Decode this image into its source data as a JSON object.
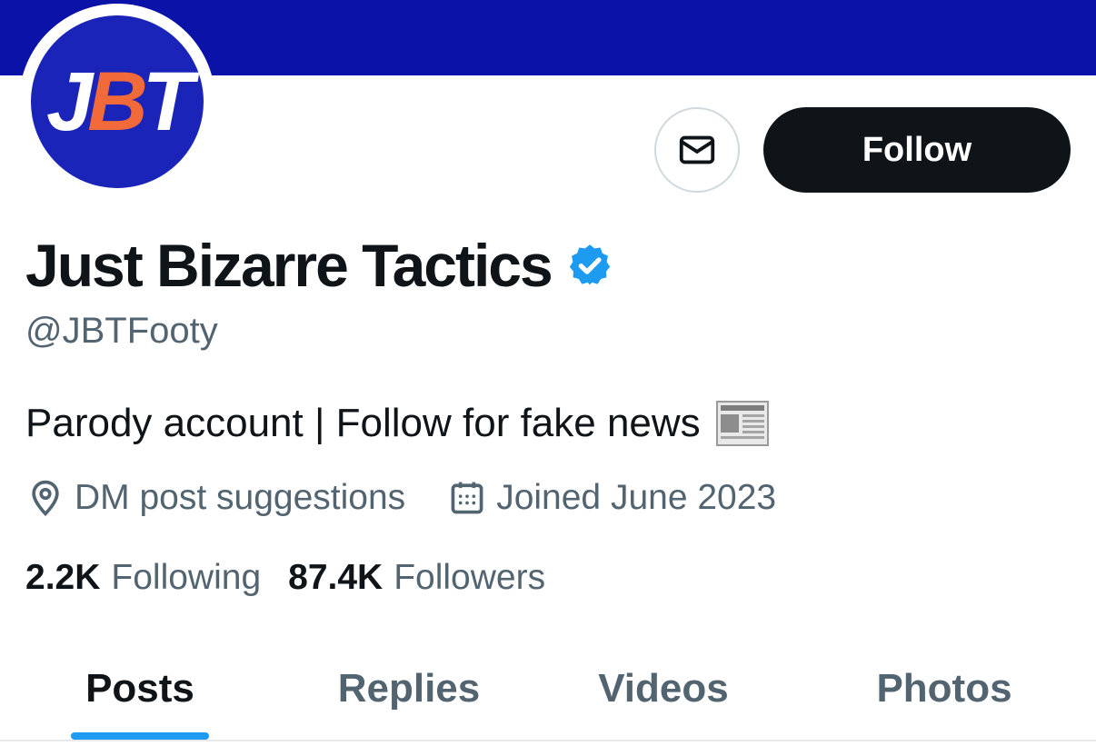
{
  "profile": {
    "avatar_text_white_1": "J",
    "avatar_text_orange": "B",
    "avatar_text_white_2": "T",
    "name": "Just Bizarre Tactics",
    "handle": "@JBTFooty",
    "bio": "Parody account | Follow for fake news",
    "location": "DM post suggestions",
    "joined": "Joined June 2023",
    "following_count": "2.2K",
    "following_label": "Following",
    "followers_count": "87.4K",
    "followers_label": "Followers"
  },
  "actions": {
    "follow_label": "Follow"
  },
  "tabs": [
    {
      "label": "Posts",
      "active": true
    },
    {
      "label": "Replies",
      "active": false
    },
    {
      "label": "Videos",
      "active": false
    },
    {
      "label": "Photos",
      "active": false
    }
  ],
  "colors": {
    "banner": "#0a12a8",
    "verified": "#1d9bf0",
    "accent_orange": "#f26a3a",
    "follow_button": "#0f1419"
  },
  "icons": {
    "message": "envelope-icon",
    "verified": "verified-badge-icon",
    "newspaper": "newspaper-emoji-icon",
    "location": "location-pin-icon",
    "calendar": "calendar-icon"
  }
}
